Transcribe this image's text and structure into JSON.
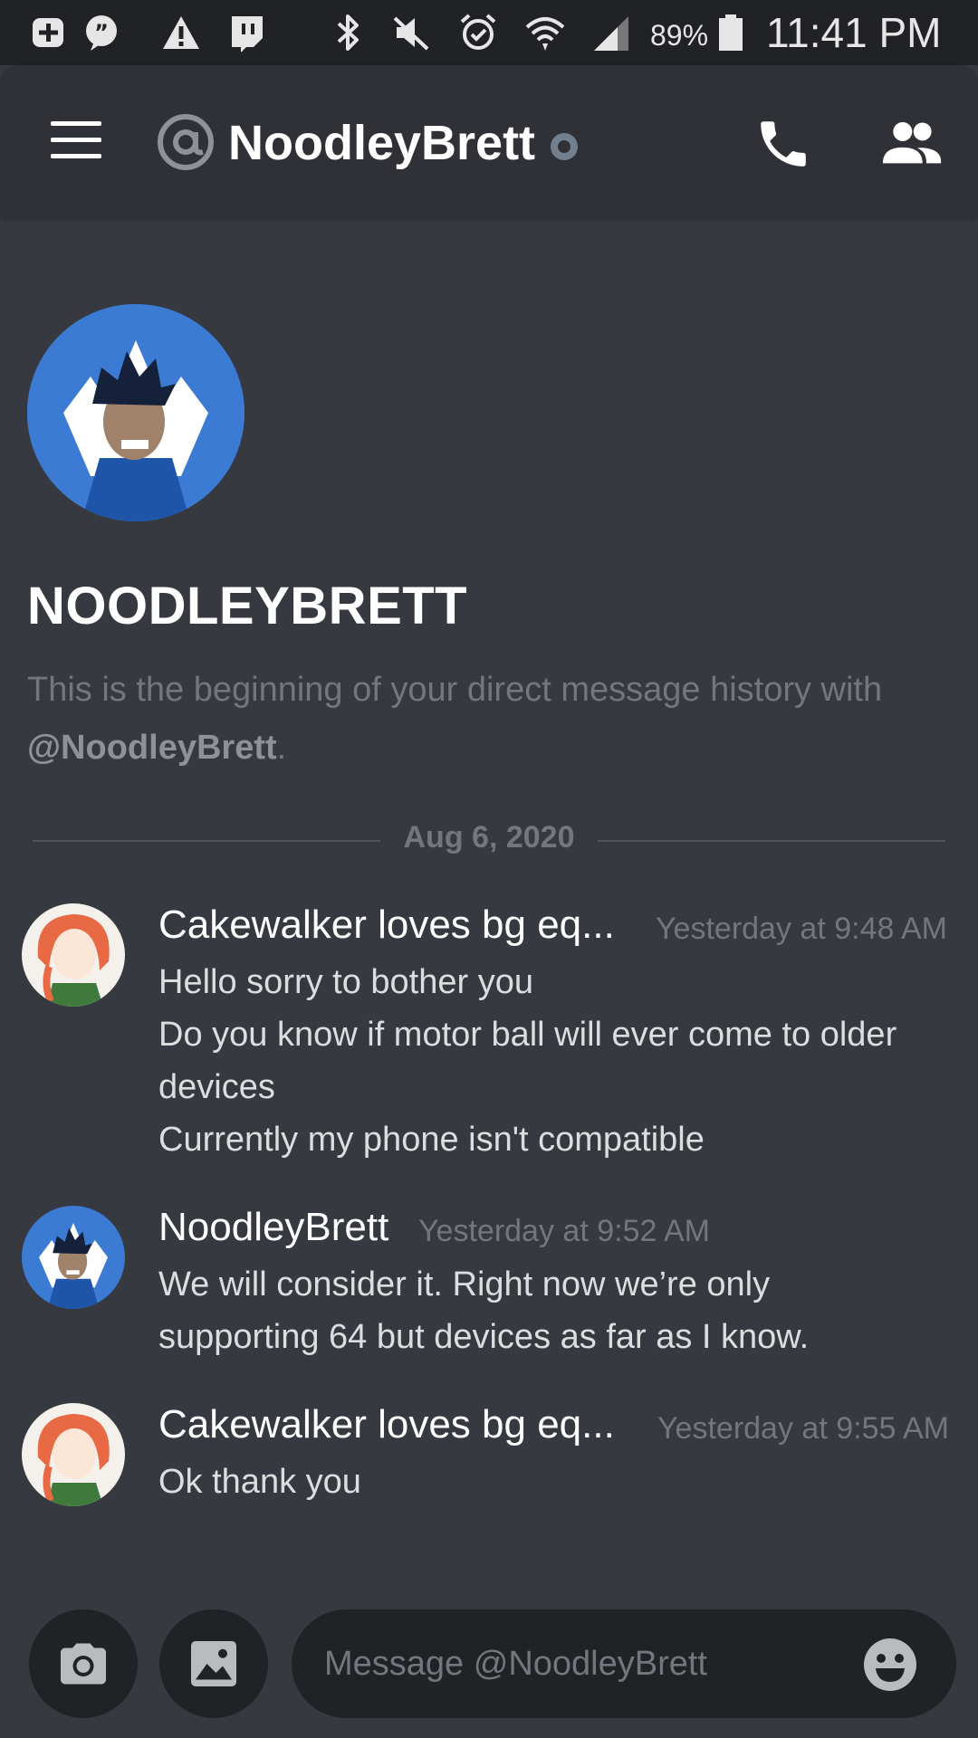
{
  "status_bar": {
    "battery_pct": "89%",
    "time": "11:41 PM",
    "icons": [
      "plus-box-icon",
      "quote-bubble-icon",
      "warning-icon",
      "twitch-icon",
      "bluetooth-icon",
      "mute-icon",
      "alarm-icon",
      "wifi-icon",
      "signal-icon",
      "battery-icon"
    ]
  },
  "header": {
    "title": "NoodleyBrett",
    "status_color": "#747f8d",
    "icons": [
      "menu-icon",
      "at-icon",
      "phone-icon",
      "members-icon"
    ]
  },
  "welcome": {
    "name": "NOODLEYBRETT",
    "desc_prefix": "This is the beginning of your direct message history with ",
    "desc_mention": "@NoodleyBrett",
    "desc_suffix": "."
  },
  "divider": {
    "date": "Aug 6, 2020"
  },
  "messages": [
    {
      "author": "Cakewalker loves bg eq...",
      "time": "Yesterday at 9:48 AM",
      "lines": [
        "Hello sorry to bother you",
        "Do you know if motor ball will ever come to older",
        "devices",
        "Currently my phone isn't compatible"
      ]
    },
    {
      "author": "NoodleyBrett",
      "time": "Yesterday at 9:52 AM",
      "lines": [
        "We will consider it. Right now we’re only",
        "supporting 64 but devices as far as I know."
      ]
    },
    {
      "author": "Cakewalker loves bg eq...",
      "time": "Yesterday at 9:55 AM",
      "lines": [
        "Ok thank you"
      ]
    }
  ],
  "composer": {
    "placeholder": "Message @NoodleyBrett",
    "value": ""
  },
  "colors": {
    "background": "#36393f",
    "header": "#2f3136",
    "input": "#202225",
    "muted_text": "#72767d"
  }
}
